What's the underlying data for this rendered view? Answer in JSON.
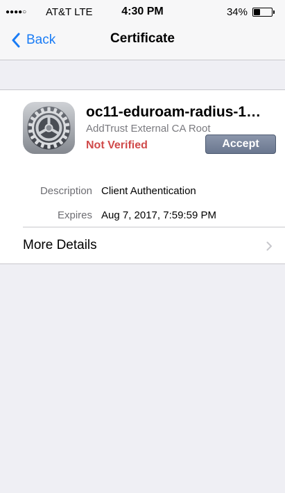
{
  "status_bar": {
    "signal": "●●●●○",
    "carrier": "AT&T LTE",
    "time": "4:30 PM",
    "battery_percent": "34%",
    "battery_level": 0.34
  },
  "nav": {
    "back_label": "Back",
    "title": "Certificate"
  },
  "certificate": {
    "name": "oc11-eduroam-radius-1…",
    "issuer": "AddTrust External CA Root",
    "verification": "Not Verified",
    "accept_label": "Accept",
    "icon": "settings-gear-icon"
  },
  "details": [
    {
      "label": "Description",
      "value": "Client Authentication"
    },
    {
      "label": "Expires",
      "value": "Aug 7, 2017, 7:59:59 PM"
    }
  ],
  "more_details": {
    "label": "More Details",
    "icon": "chevron-right-icon"
  },
  "colors": {
    "accent": "#1a7cf5",
    "not_verified": "#d04a4a",
    "background": "#efeff4"
  }
}
